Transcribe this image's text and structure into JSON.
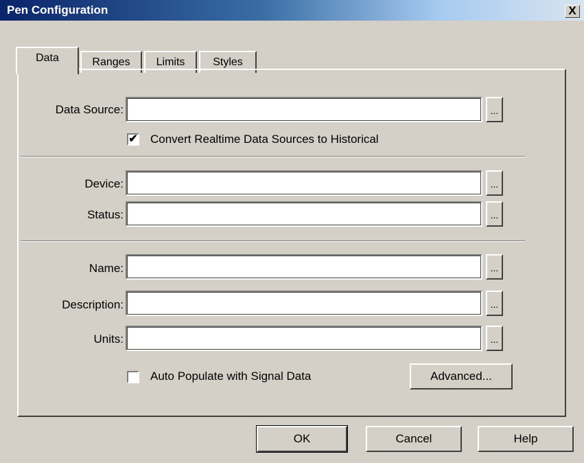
{
  "window": {
    "title": "Pen Configuration",
    "close_label": "X"
  },
  "tabs": [
    {
      "label": "Data"
    },
    {
      "label": "Ranges"
    },
    {
      "label": "Limits"
    },
    {
      "label": "Styles"
    }
  ],
  "data_tab": {
    "data_source": {
      "label": "Data Source:",
      "value": "",
      "browse_label": "..."
    },
    "convert_realtime": {
      "label": "Convert Realtime Data Sources to Historical",
      "checked": true
    },
    "device": {
      "label": "Device:",
      "value": "",
      "browse_label": "..."
    },
    "status": {
      "label": "Status:",
      "value": "",
      "browse_label": "..."
    },
    "name": {
      "label": "Name:",
      "value": "",
      "browse_label": "..."
    },
    "description": {
      "label": "Description:",
      "value": "",
      "browse_label": "..."
    },
    "units": {
      "label": "Units:",
      "value": "",
      "browse_label": "..."
    },
    "auto_populate": {
      "label": "Auto Populate with Signal Data",
      "checked": false
    },
    "advanced_label": "Advanced..."
  },
  "footer": {
    "ok_label": "OK",
    "cancel_label": "Cancel",
    "help_label": "Help"
  },
  "check_glyph": "✔"
}
